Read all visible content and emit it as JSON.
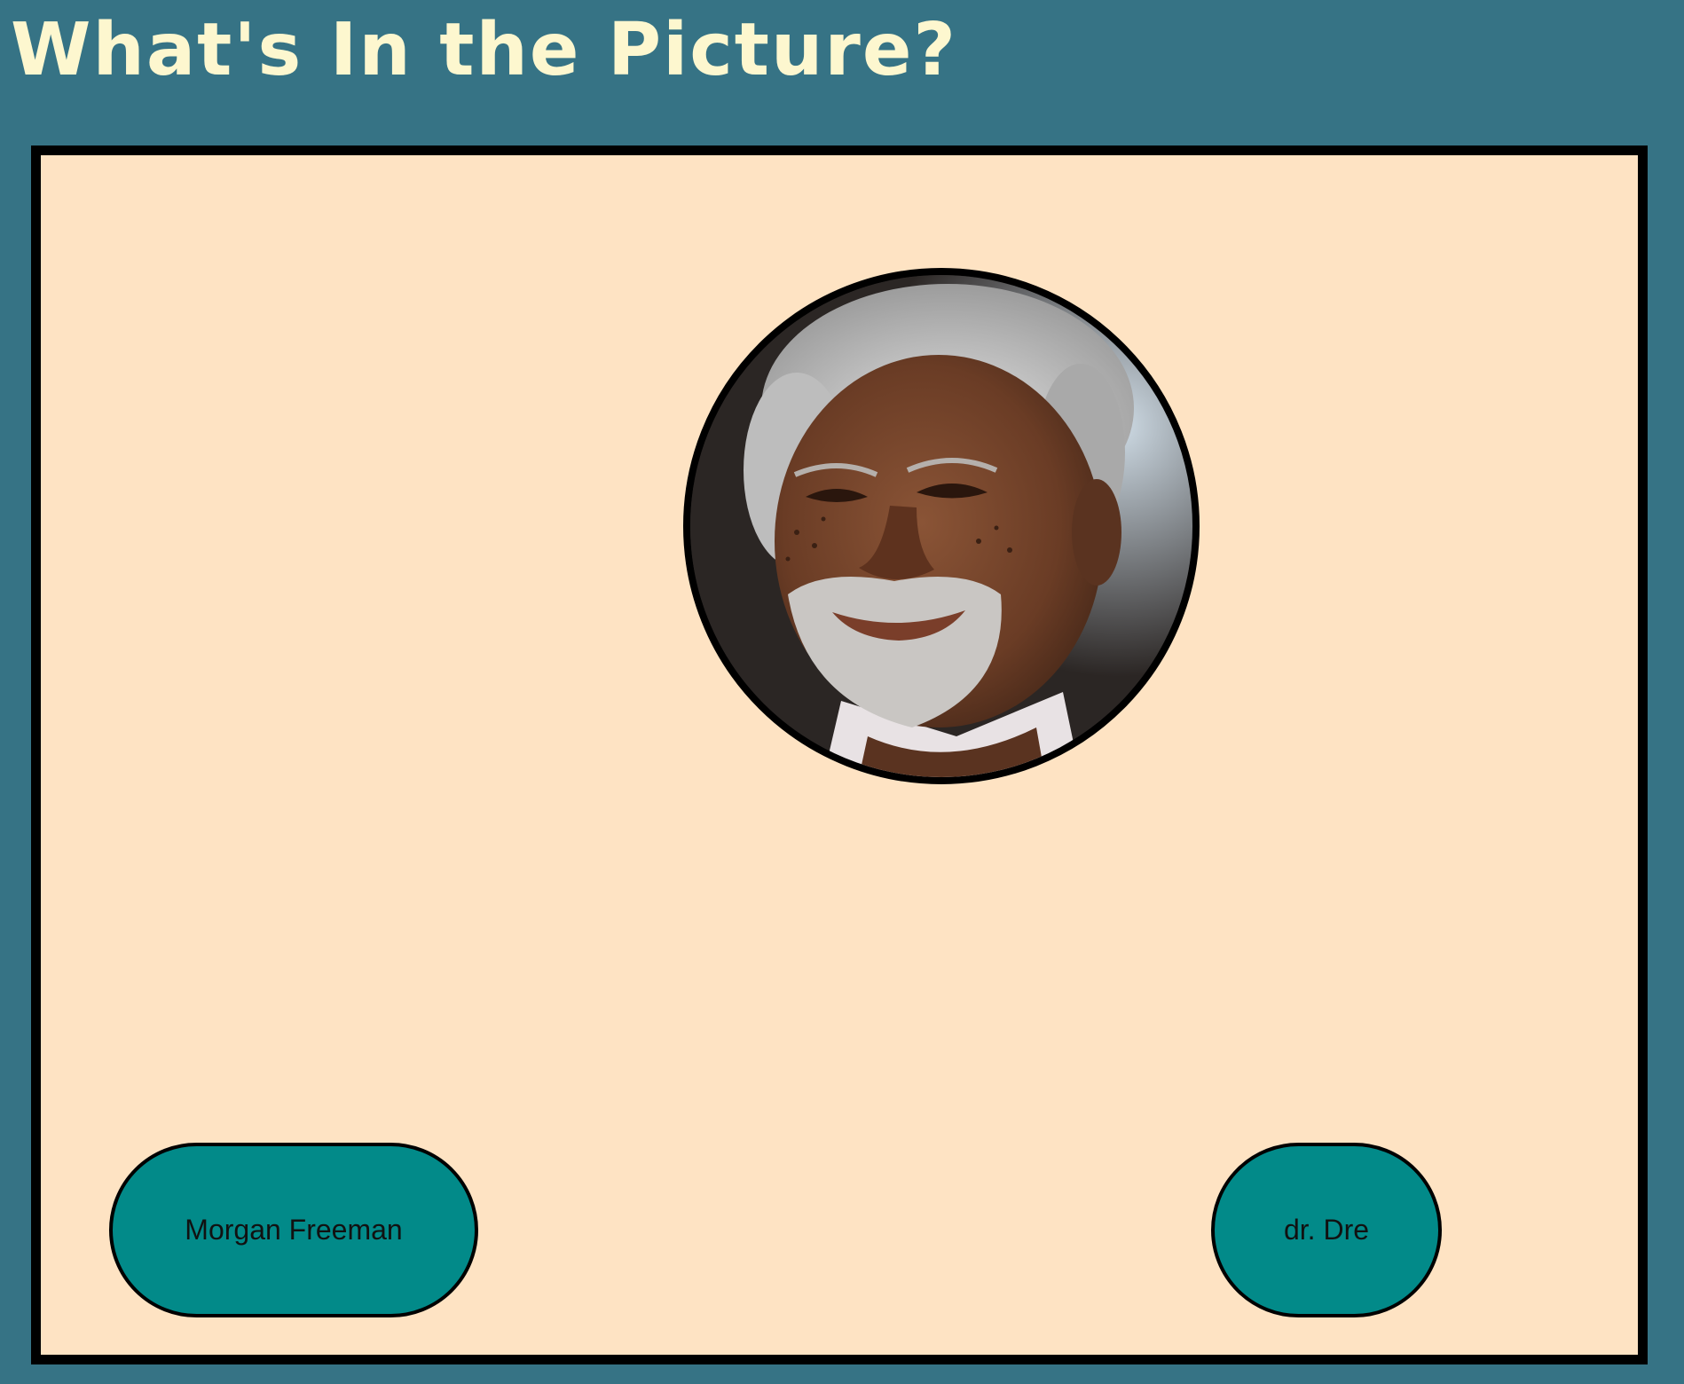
{
  "header": {
    "title": "What's In the Picture?"
  },
  "quiz": {
    "image_icon": "portrait-photo",
    "choices": [
      {
        "label": "Morgan Freeman"
      },
      {
        "label": "dr. Dre"
      }
    ]
  },
  "colors": {
    "page_background": "#367385",
    "title_text": "#fdf7cf",
    "board_background": "#fee3c3",
    "button_fill": "#028a89",
    "border": "#000000"
  }
}
